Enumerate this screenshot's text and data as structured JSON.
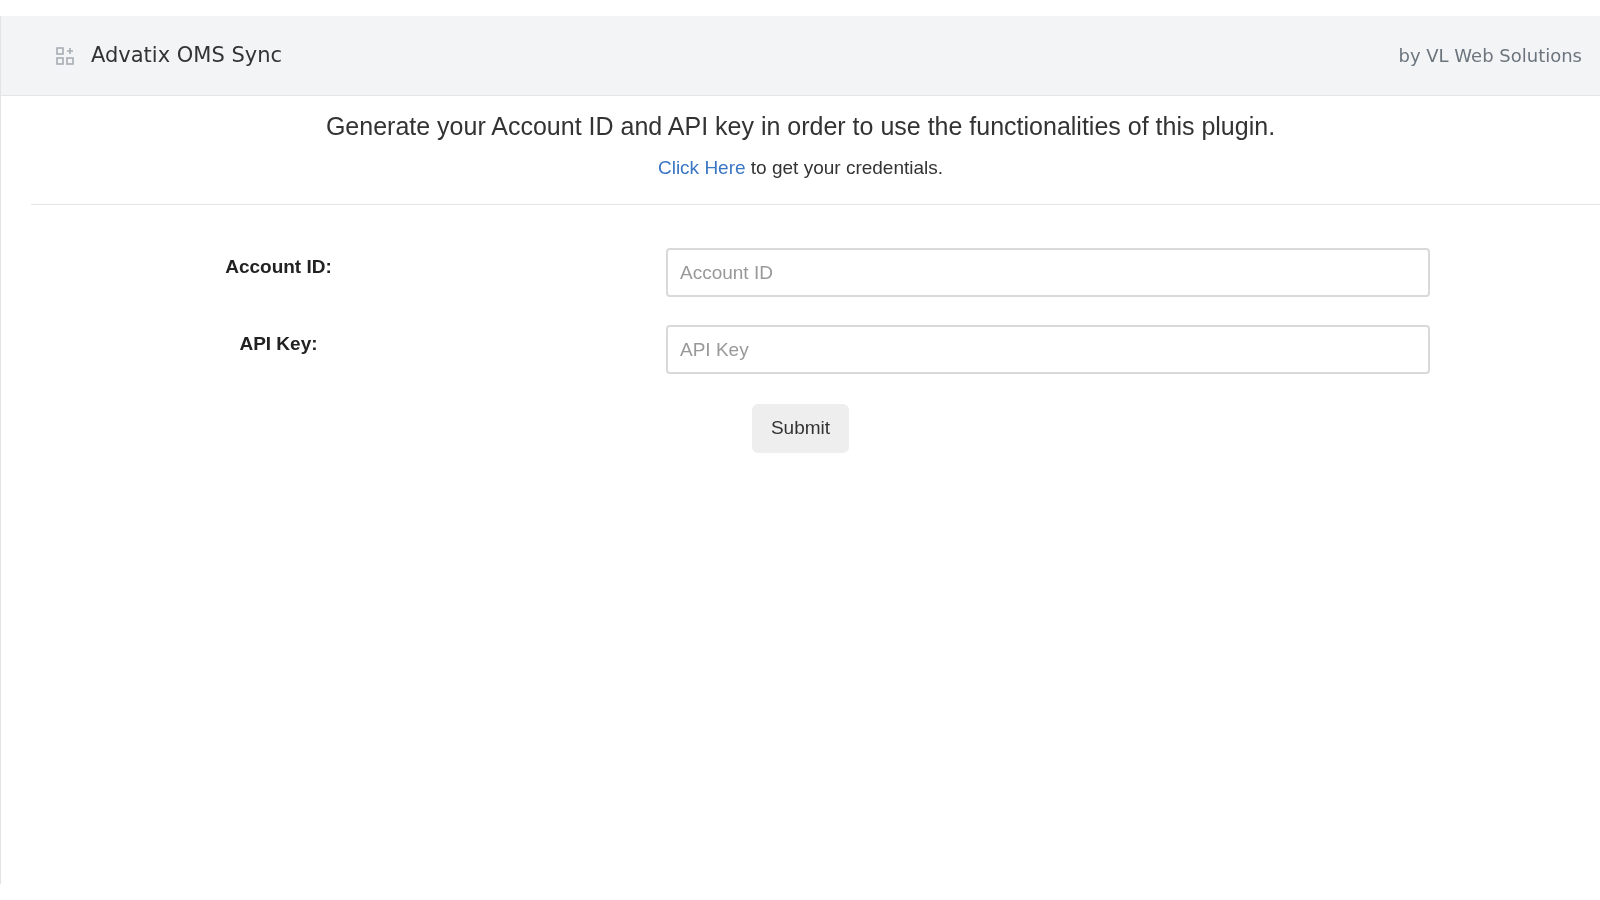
{
  "header": {
    "title": "Advatix OMS Sync",
    "byline": "by VL Web Solutions"
  },
  "intro": {
    "heading": "Generate your Account ID and API key in order to use the functionalities of this plugin.",
    "link": "Click Here",
    "link_rest": " to get your credentials."
  },
  "fields": [
    {
      "label": "Account ID:",
      "placeholder": "Account ID"
    },
    {
      "label": "API Key:",
      "placeholder": "API Key"
    }
  ],
  "submit": "Submit"
}
